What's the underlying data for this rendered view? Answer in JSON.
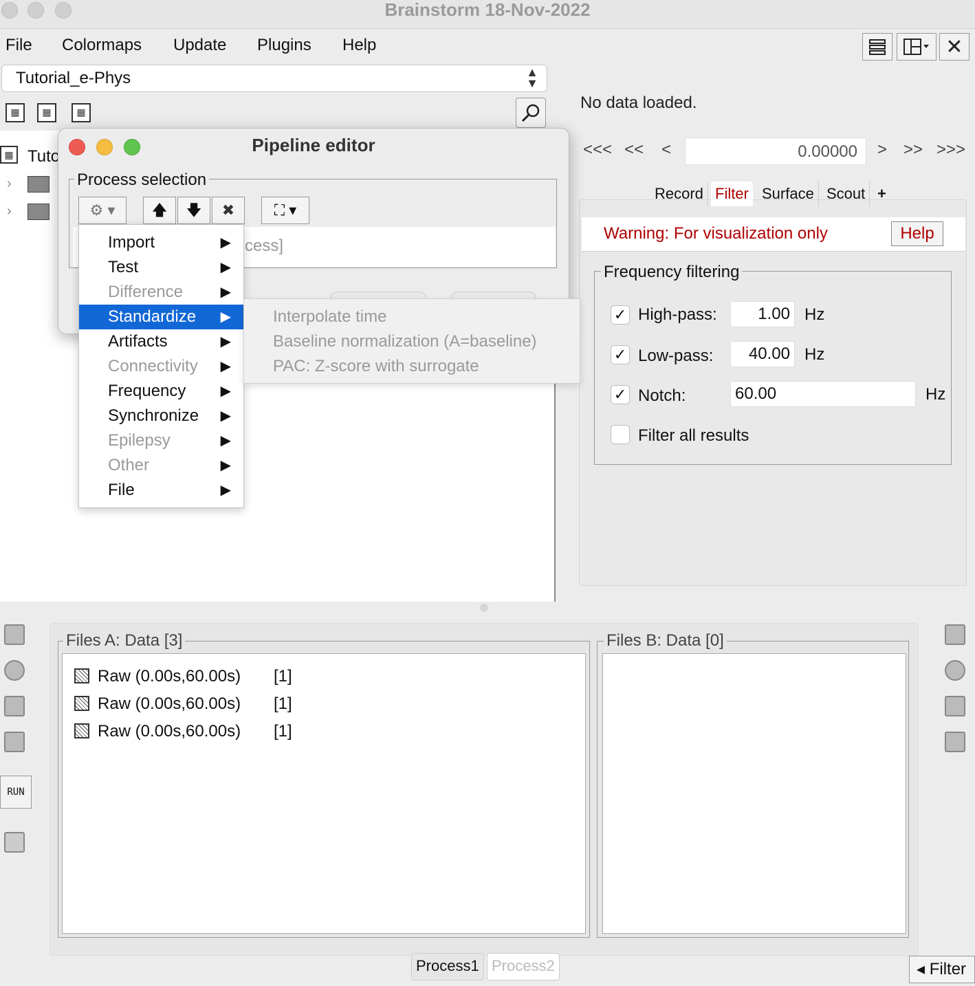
{
  "window": {
    "title": "Brainstorm 18-Nov-2022"
  },
  "menubar": {
    "items": [
      "File",
      "Colormaps",
      "Update",
      "Plugins",
      "Help"
    ]
  },
  "toolbar_right": {
    "icons": [
      "list-layout-icon",
      "window-layout-icon",
      "close-all-icon"
    ],
    "close_glyph": "✕"
  },
  "protocol": {
    "selected": "Tutorial_e-Phys",
    "chevron": "⌃⌄"
  },
  "tree": {
    "root_label": "Tuto"
  },
  "right": {
    "no_data": "No data loaded.",
    "nav": [
      "<<<",
      "<<",
      "<",
      ">",
      ">>",
      ">>>"
    ],
    "time_value": "0.00000",
    "tabs": [
      "Record",
      "Filter",
      "Surface",
      "Scout",
      "+"
    ],
    "active_tab": "Filter",
    "warning": "Warning:  For visualization only",
    "help": "Help",
    "freq_legend": "Frequency filtering",
    "highpass": {
      "label": "High-pass:",
      "value": "1.00",
      "unit": "Hz",
      "checked": true
    },
    "lowpass": {
      "label": "Low-pass:",
      "value": "40.00",
      "unit": "Hz",
      "checked": true
    },
    "notch": {
      "label": "Notch:",
      "value": "60.00",
      "unit": "Hz",
      "checked": true
    },
    "filter_all": {
      "label": "Filter all results",
      "checked": false
    },
    "check_glyph": "✓"
  },
  "files": {
    "a_legend": "Files A: Data [3]",
    "b_legend": "Files B: Data [0]",
    "a_rows": [
      {
        "name": "Raw (0.00s,60.00s)",
        "count": "[1]"
      },
      {
        "name": "Raw (0.00s,60.00s)",
        "count": "[1]"
      },
      {
        "name": "Raw (0.00s,60.00s)",
        "count": "[1]"
      }
    ],
    "run_label": "RUN",
    "process_tabs": [
      "Process1",
      "Process2"
    ],
    "filter_toggle": "◂ Filter"
  },
  "pipeline": {
    "title": "Pipeline editor",
    "legend": "Process selection",
    "empty_hint": "cess]",
    "tool_up": "🡅",
    "tool_down": "🡇",
    "tool_del": "✖",
    "tool_gear": "⚙ ▾",
    "tool_tree": "⛶ ▾"
  },
  "context_menu": {
    "items": [
      {
        "label": "Import",
        "enabled": true
      },
      {
        "label": "Test",
        "enabled": true
      },
      {
        "label": "Difference",
        "enabled": false
      },
      {
        "label": "Standardize",
        "enabled": true,
        "selected": true
      },
      {
        "label": "Artifacts",
        "enabled": true
      },
      {
        "label": "Connectivity",
        "enabled": false
      },
      {
        "label": "Frequency",
        "enabled": true
      },
      {
        "label": "Synchronize",
        "enabled": true
      },
      {
        "label": "Epilepsy",
        "enabled": false
      },
      {
        "label": "Other",
        "enabled": false
      },
      {
        "label": "File",
        "enabled": true
      }
    ],
    "arrow": "▶"
  },
  "submenu": {
    "items": [
      "Interpolate time",
      "Baseline normalization (A=baseline)",
      "PAC: Z-score with surrogate"
    ]
  },
  "colors": {
    "accent": "#1267d6",
    "warning": "#b00000"
  }
}
